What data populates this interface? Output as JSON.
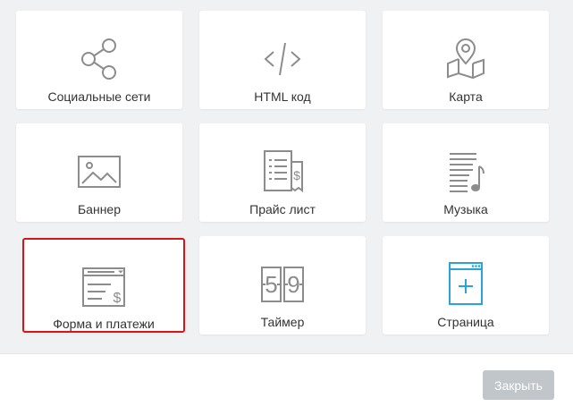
{
  "tiles": [
    {
      "label": "Социальные сети",
      "icon": "share-icon"
    },
    {
      "label": "HTML код",
      "icon": "code-icon"
    },
    {
      "label": "Карта",
      "icon": "map-icon"
    },
    {
      "label": "Баннер",
      "icon": "image-icon"
    },
    {
      "label": "Прайс лист",
      "icon": "price-list-icon"
    },
    {
      "label": "Музыка",
      "icon": "music-icon"
    },
    {
      "label": "Форма и платежи",
      "icon": "form-payment-icon",
      "selected": true
    },
    {
      "label": "Таймер",
      "icon": "timer-icon",
      "digits": [
        "5",
        "9"
      ]
    },
    {
      "label": "Страница",
      "icon": "page-icon"
    }
  ],
  "footer": {
    "close_label": "Закрыть"
  },
  "colors": {
    "icon_gray": "#8c8c8c",
    "icon_blue": "#2aa3db",
    "selection_red": "#d7141a",
    "button_gray": "#c1c6cb"
  }
}
